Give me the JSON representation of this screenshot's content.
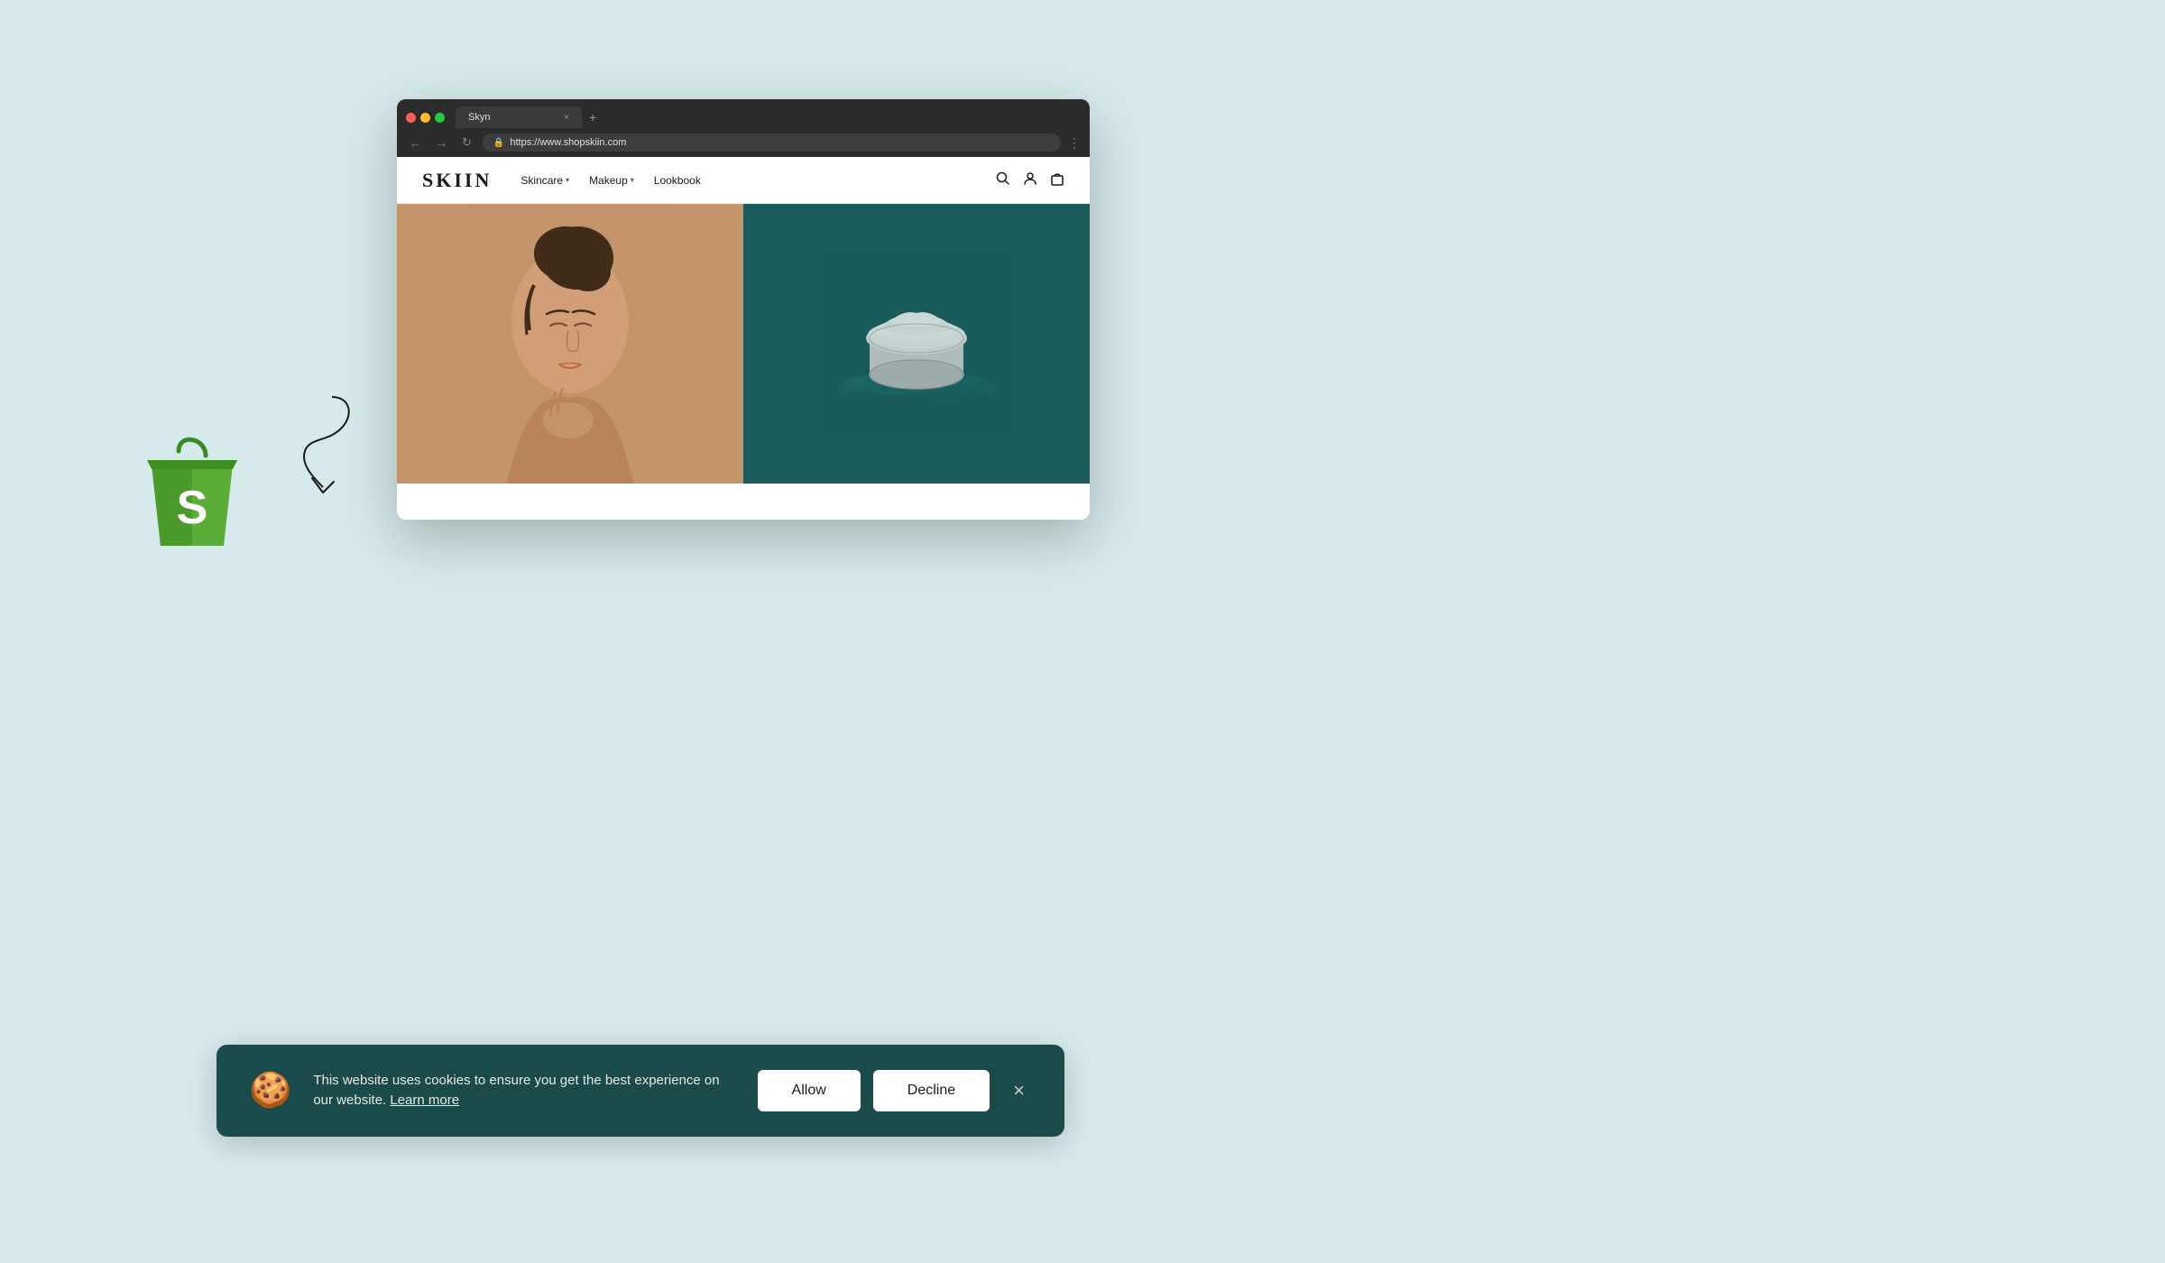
{
  "page": {
    "background_color": "#d6eaeb"
  },
  "browser": {
    "tab_title": "Skyn",
    "url": "https://www.shopskiin.com",
    "tab_close": "×",
    "tab_new": "+",
    "nav_back": "←",
    "nav_forward": "→",
    "nav_refresh": "↻",
    "lock_symbol": "🔒",
    "menu_symbol": "⋮"
  },
  "website": {
    "logo": "SKIIN",
    "nav": {
      "skincare": "Skincare",
      "makeup": "Makeup",
      "lookbook": "Lookbook",
      "skincare_chevron": "▾",
      "makeup_chevron": "▾"
    },
    "header_icons": {
      "search": "🔍",
      "account": "👤",
      "cart": "🛍"
    }
  },
  "cookie_banner": {
    "icon": "🍪",
    "message": "This website uses cookies to ensure you get the best experience on our website.",
    "learn_more": "Learn more",
    "allow_label": "Allow",
    "decline_label": "Decline",
    "close_label": "×",
    "background_color": "#1a4a4a"
  },
  "shopify": {
    "bag_color_top": "#5aad37",
    "bag_color_body": "#4a9a2c",
    "s_letter": "S"
  }
}
